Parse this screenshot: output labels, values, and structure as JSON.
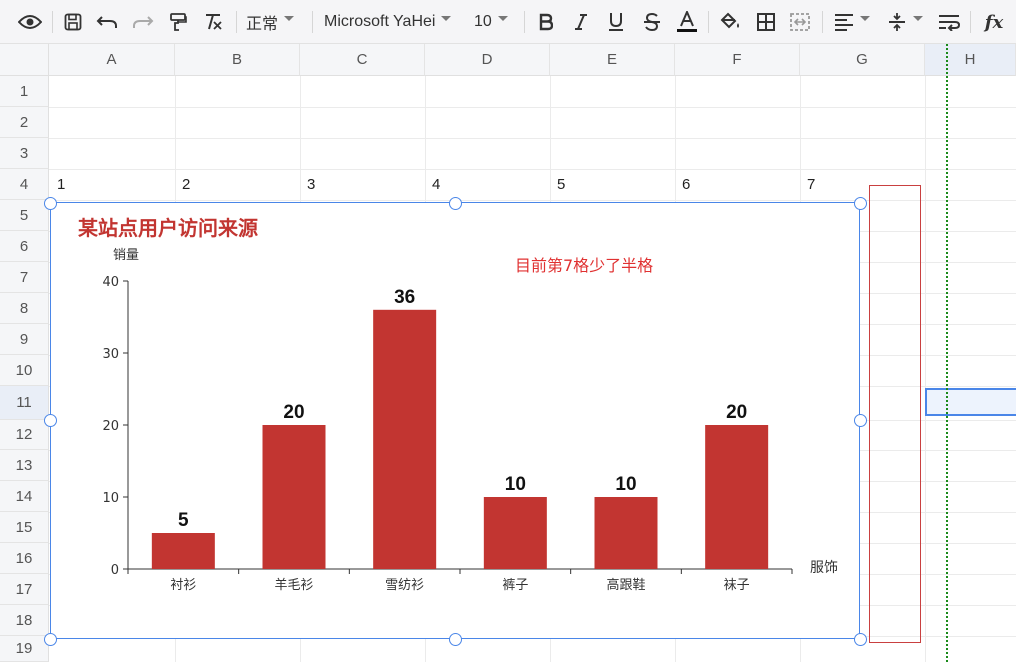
{
  "toolbar": {
    "style_label": "正常",
    "font_label": "Microsoft YaHei",
    "size_label": "10",
    "fx_label": "fx"
  },
  "columns": [
    "A",
    "B",
    "C",
    "D",
    "E",
    "F",
    "G",
    "H"
  ],
  "rows": [
    "1",
    "2",
    "3",
    "4",
    "5",
    "6",
    "7",
    "8",
    "9",
    "10",
    "11",
    "12",
    "13",
    "14",
    "15",
    "16",
    "17",
    "18",
    "19"
  ],
  "row4_values": [
    "1",
    "2",
    "3",
    "4",
    "5",
    "6",
    "7"
  ],
  "colors": {
    "bar": "#c23531",
    "selection": "#4a86e8",
    "annotation": "#e03131",
    "guide": "#1a8a1a"
  },
  "annotation": "目前第7格少了半格",
  "chart_data": {
    "type": "bar",
    "title": "某站点用户访问来源",
    "xlabel": "服饰",
    "ylabel": "销量",
    "categories": [
      "衬衫",
      "羊毛衫",
      "雪纺衫",
      "裤子",
      "高跟鞋",
      "袜子"
    ],
    "values": [
      5,
      20,
      36,
      10,
      10,
      20
    ],
    "ylim": [
      0,
      40
    ],
    "yticks": [
      "0",
      "10",
      "20",
      "30",
      "40"
    ],
    "data_labels": [
      "5",
      "20",
      "36",
      "10",
      "10",
      "20"
    ],
    "legend": "none",
    "grid": false
  }
}
